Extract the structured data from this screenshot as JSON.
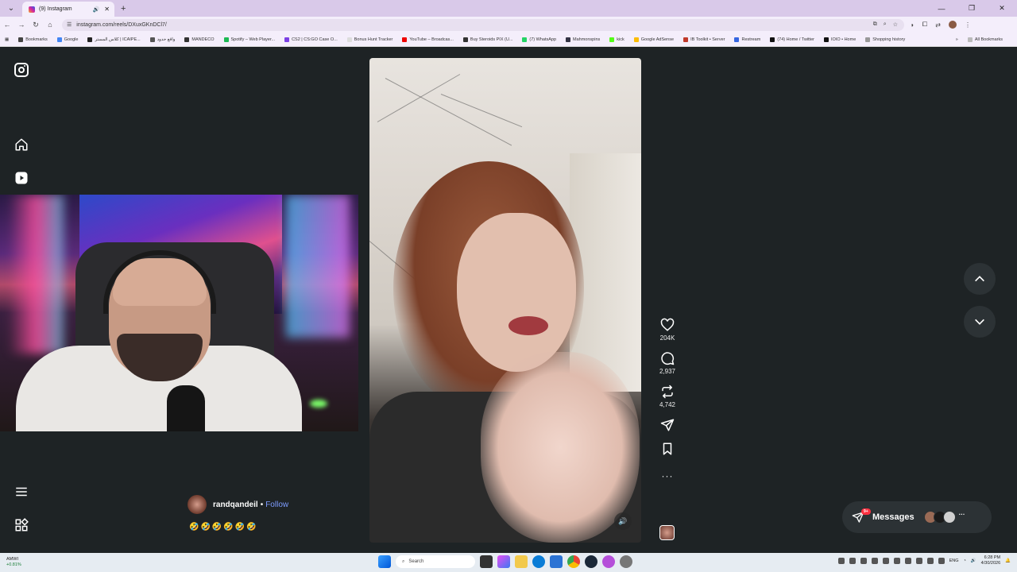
{
  "browser": {
    "tab_title": "(9) Instagram",
    "url": "instagram.com/reels/DXuxGKnDCl7/",
    "bookmarks": [
      {
        "label": "Bookmarks",
        "color": "#444"
      },
      {
        "label": "Google",
        "color": "#4285f4"
      },
      {
        "label": "كلاس المستر | ICAIPE...",
        "color": "#222"
      },
      {
        "label": "واقع حدود",
        "color": "#555"
      },
      {
        "label": "MANDECO",
        "color": "#333"
      },
      {
        "label": "Spotify – Web Player...",
        "color": "#1db954"
      },
      {
        "label": "CS2 | CS:GO Case O...",
        "color": "#7b3fe4"
      },
      {
        "label": "Bonus Hunt Tracker",
        "color": "#ddd"
      },
      {
        "label": "YouTube – Broadcas...",
        "color": "#e00"
      },
      {
        "label": "Buy Steroids PIX (U...",
        "color": "#333"
      },
      {
        "label": "(7) WhatsApp",
        "color": "#25d366"
      },
      {
        "label": "Mahmonspins",
        "color": "#334"
      },
      {
        "label": "kick",
        "color": "#53fc18"
      },
      {
        "label": "Google AdSense",
        "color": "#fbbc04"
      },
      {
        "label": "IB Toolkit • Server",
        "color": "#c0392b"
      },
      {
        "label": "Restream",
        "color": "#3566e0"
      },
      {
        "label": "(74) Home / Twitter",
        "color": "#111"
      },
      {
        "label": "IOIO • Home",
        "color": "#111"
      },
      {
        "label": "Shopping history",
        "color": "#999"
      }
    ],
    "all_bookmarks_label": "All Bookmarks"
  },
  "reel": {
    "author": "randqandeil",
    "separator": "•",
    "follow_label": "Follow",
    "caption": "🤣🤣🤣🤣🤣🤣",
    "likes": "204K",
    "comments": "2,937",
    "reposts": "4,742"
  },
  "messages": {
    "label": "Messages",
    "badge": "9+"
  },
  "taskbar": {
    "stock_name": "AMWI",
    "stock_change": "+0.81%",
    "search_placeholder": "Search",
    "language": "ENG",
    "time": "6:28 PM",
    "date": "4/30/2026"
  },
  "colors": {
    "follow": "#7e9cff",
    "page_bg": "#1e2325",
    "badge": "#ff3040"
  }
}
